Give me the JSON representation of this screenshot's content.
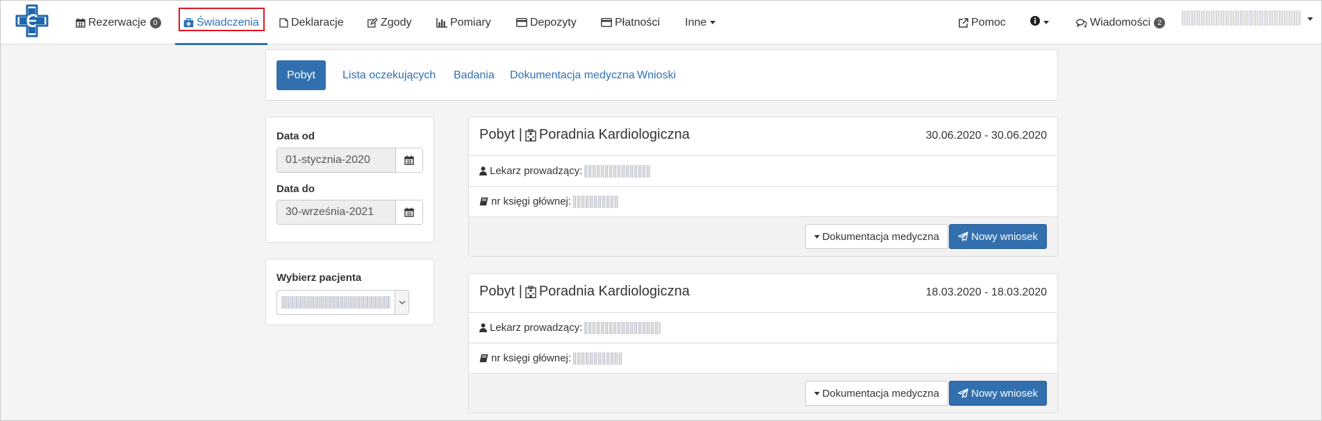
{
  "nav": {
    "items": [
      {
        "label": "Rezerwacje",
        "badge": "0",
        "icon": "calendar-icon"
      },
      {
        "label": "Świadczenia",
        "icon": "medkit-icon",
        "active": true
      },
      {
        "label": "Deklaracje",
        "icon": "file-icon"
      },
      {
        "label": "Zgody",
        "icon": "edit-icon"
      },
      {
        "label": "Pomiary",
        "icon": "bar-chart-icon"
      },
      {
        "label": "Depozyty",
        "icon": "card-icon"
      },
      {
        "label": "Płatności",
        "icon": "card-icon"
      },
      {
        "label": "Inne",
        "icon": "chevron-down-icon"
      }
    ],
    "right": {
      "help": "Pomoc",
      "messages": "Wiadomości",
      "messages_badge": "2"
    }
  },
  "subnav": {
    "tabs": [
      {
        "label": "Pobyt",
        "active": true
      },
      {
        "label": "Lista oczekujących"
      },
      {
        "label": "Badania"
      },
      {
        "label": "Dokumentacja medyczna"
      },
      {
        "label": "Wnioski"
      }
    ]
  },
  "filters": {
    "date_from_label": "Data od",
    "date_from_value": "01-stycznia-2020",
    "date_to_label": "Data do",
    "date_to_value": "30-września-2021",
    "patient_label": "Wybierz pacjenta"
  },
  "visits": [
    {
      "title_prefix": "Pobyt |",
      "clinic": "Poradnia Kardiologiczna",
      "dates": "30.06.2020 - 30.06.2020",
      "doctor_label": "Lekarz prowadzący:",
      "book_label": "nr księgi głównej:",
      "doc_button": "Dokumentacja medyczna",
      "new_button": "Nowy wniosek"
    },
    {
      "title_prefix": "Pobyt |",
      "clinic": "Poradnia Kardiologiczna",
      "dates": "18.03.2020 - 18.03.2020",
      "doctor_label": "Lekarz prowadzący:",
      "book_label": "nr księgi głównej:",
      "doc_button": "Dokumentacja medyczna",
      "new_button": "Nowy wniosek"
    }
  ],
  "colors": {
    "primary": "#326fae",
    "link": "#2f70b3",
    "highlight": "#e0141e"
  }
}
